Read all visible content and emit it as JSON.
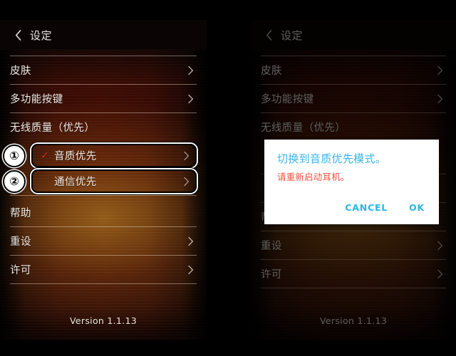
{
  "header": {
    "back_icon": "chevron-left-icon",
    "title": "设定"
  },
  "list": {
    "rows": [
      {
        "label": "皮肤",
        "chevron": true
      },
      {
        "label": "多功能按键",
        "chevron": true
      },
      {
        "label": "无线质量（优先）",
        "chevron": false
      }
    ],
    "options": [
      {
        "badge": "①",
        "label": "音质优先",
        "checked": "✓",
        "chevron": true
      },
      {
        "badge": "②",
        "label": "通信优先",
        "checked": "",
        "chevron": true
      }
    ],
    "rows_bottom": [
      {
        "label": "帮助",
        "chevron": false
      },
      {
        "label": "重设",
        "chevron": true
      },
      {
        "label": "许可",
        "chevron": true
      }
    ]
  },
  "footer": {
    "version": "Version 1.1.13"
  },
  "dialog": {
    "title": "切换到音质优先模式。",
    "message": "请重新启动耳机。",
    "cancel_label": "CANCEL",
    "ok_label": "OK",
    "title_color": "#3ab3e8",
    "message_color": "#f0503c",
    "button_color": "#29b6e8"
  },
  "theme": {
    "header_bg": "#0a0504",
    "check_color": "#e02b12",
    "divider_color": "#ffebd7"
  }
}
